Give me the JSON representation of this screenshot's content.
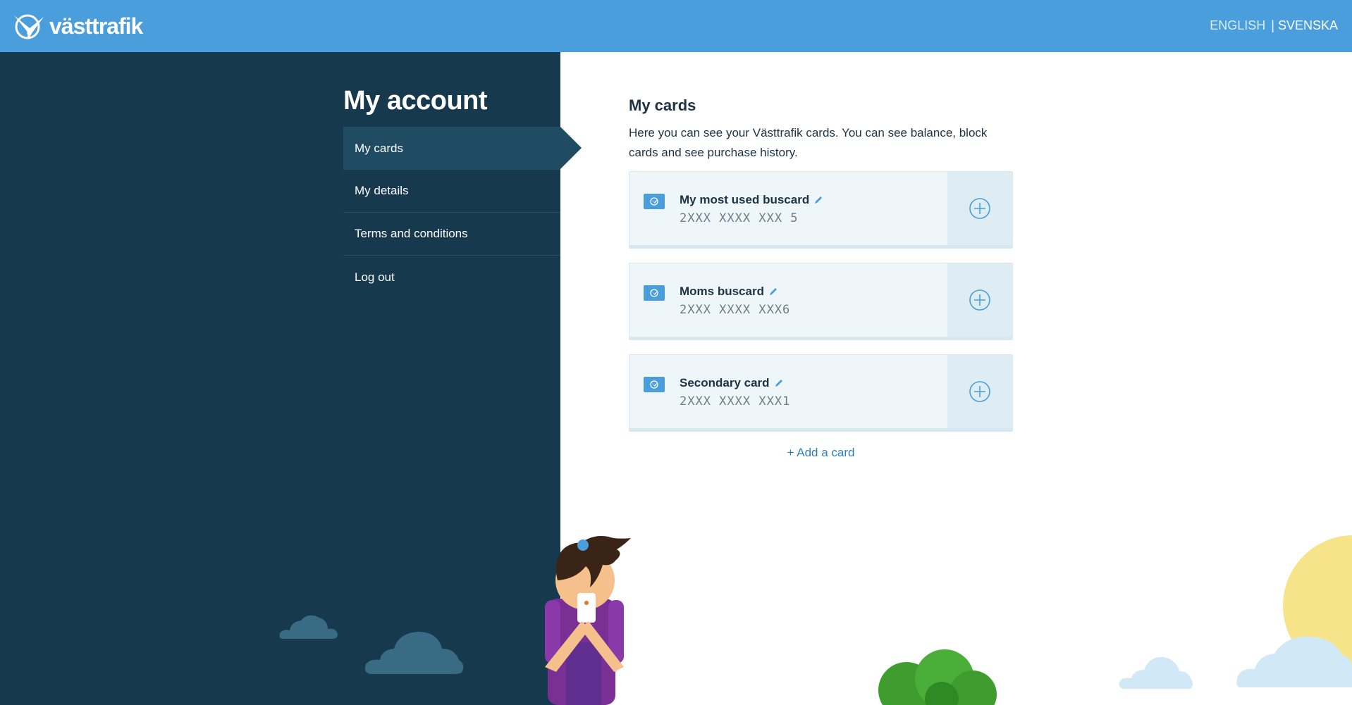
{
  "header": {
    "brand": "västtrafik",
    "lang_english": "ENGLISH",
    "lang_swedish": "| SVENSKA"
  },
  "sidebar": {
    "title": "My account",
    "items": [
      {
        "label": "My cards",
        "active": true
      },
      {
        "label": "My details",
        "active": false
      },
      {
        "label": "Terms and conditions",
        "active": false
      },
      {
        "label": "Log out",
        "active": false
      }
    ]
  },
  "main": {
    "title": "My cards",
    "description": "Here you can see your Västtrafik cards. You can see balance, block cards and see purchase history.",
    "cards": [
      {
        "name": "My most used buscard",
        "number": "2XXX XXXX XXX 5"
      },
      {
        "name": "Moms buscard",
        "number": "2XXX XXXX XXX6"
      },
      {
        "name": "Secondary card",
        "number": "2XXX XXXX XXX1"
      }
    ],
    "add_card_label": "+ Add a card"
  },
  "colors": {
    "header_bg": "#4a9edb",
    "sidebar_bg": "#16394e",
    "nav_active_bg": "#1f4c63",
    "link": "#2a7fc4"
  },
  "icons": {
    "logo": "vasttrafik-logo-icon",
    "card": "card-icon",
    "edit": "pencil-icon",
    "expand": "plus-circle-icon"
  }
}
